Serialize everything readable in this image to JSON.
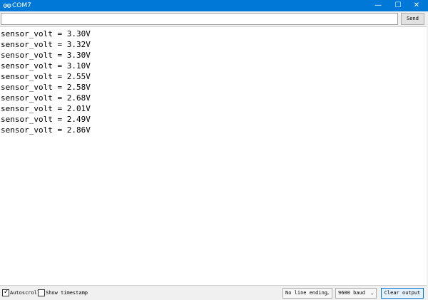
{
  "window": {
    "title": "COM7",
    "controls": {
      "minimize": "—",
      "maximize": "☐",
      "close": "✕"
    }
  },
  "send_bar": {
    "input_value": "",
    "input_placeholder": "",
    "send_label": "Send"
  },
  "output": {
    "lines": [
      "sensor_volt = 3.30V",
      "sensor_volt = 3.32V",
      "sensor_volt = 3.30V",
      "sensor_volt = 3.10V",
      "sensor_volt = 2.55V",
      "sensor_volt = 2.58V",
      "sensor_volt = 2.68V",
      "sensor_volt = 2.01V",
      "sensor_volt = 2.49V",
      "sensor_volt = 2.86V"
    ]
  },
  "status_bar": {
    "autoscroll": {
      "label": "Autoscroll",
      "checked": true
    },
    "show_timestamp": {
      "label": "Show timestamp",
      "checked": false
    },
    "line_ending": {
      "selected": "No line ending"
    },
    "baud": {
      "selected": "9600 baud"
    },
    "clear_label": "Clear output"
  },
  "colors": {
    "titlebar": "#0078d7",
    "output_bg": "#ffffff",
    "chrome_bg": "#f0f0f0"
  },
  "icons": {
    "app": "arduino-infinity-icon",
    "minimize": "minimize-icon",
    "maximize": "maximize-icon",
    "close": "close-icon",
    "dropdown": "chevron-down-icon",
    "checkbox": "checkmark-icon"
  }
}
